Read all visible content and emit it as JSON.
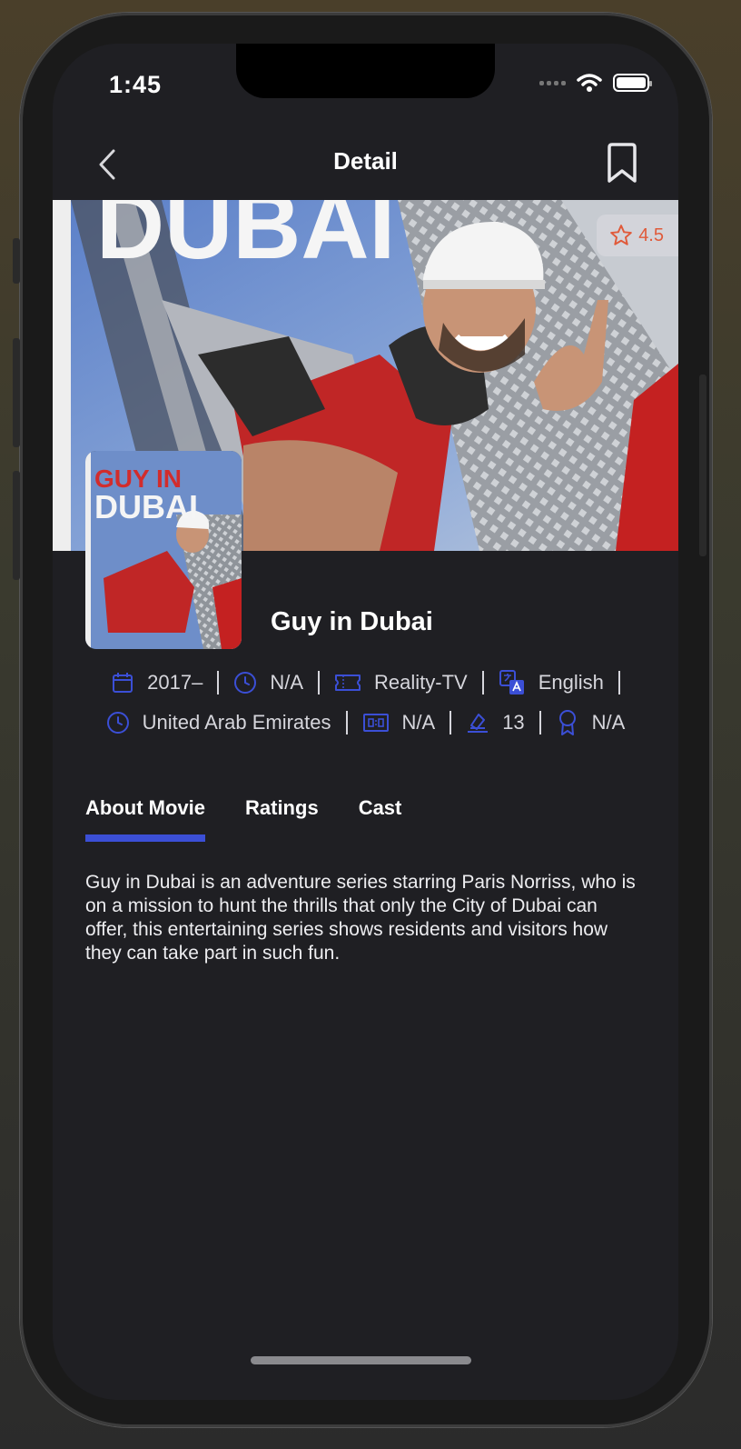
{
  "status": {
    "time": "1:45"
  },
  "nav": {
    "title": "Detail"
  },
  "hero": {
    "banner_text": "DUBAI",
    "rating": "4.5"
  },
  "poster": {
    "line1": "GUY IN",
    "line2": "DUBAI"
  },
  "movie": {
    "title": "Guy in Dubai",
    "year": "2017–",
    "runtime": "N/A",
    "genre": "Reality-TV",
    "language": "English",
    "country": "United Arab Emirates",
    "score": "N/A",
    "rated": "13",
    "awards": "N/A"
  },
  "tabs": [
    {
      "label": "About Movie",
      "active": true
    },
    {
      "label": "Ratings",
      "active": false
    },
    {
      "label": "Cast",
      "active": false
    }
  ],
  "about": {
    "text": "Guy in Dubai is an adventure series starring Paris Norriss, who is on a mission to hunt the thrills that only the City of Dubai can offer, this entertaining series shows residents and visitors how they can take part in such fun."
  },
  "colors": {
    "accent": "#3b4fd6",
    "rating": "#e05a3a",
    "background": "#1f1f23"
  },
  "icons": [
    "chevron-left-icon",
    "bookmark-icon",
    "star-icon",
    "calendar-icon",
    "clock-icon",
    "ticket-icon",
    "translate-icon",
    "score-icon",
    "rated-icon",
    "award-icon"
  ]
}
